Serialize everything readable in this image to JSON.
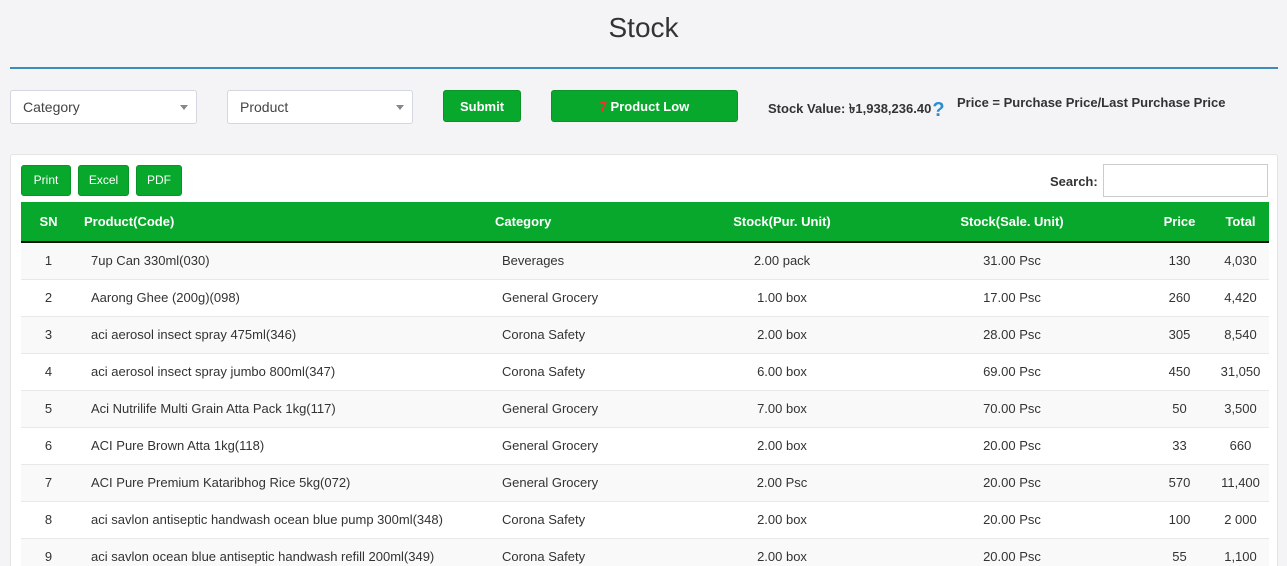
{
  "page": {
    "title": "Stock"
  },
  "filters": {
    "category_placeholder": "Category",
    "product_placeholder": "Product",
    "submit_label": "Submit",
    "low_count": "7",
    "low_label": " Product Low",
    "stock_value_label": "Stock Value: ",
    "stock_value_amount": "৳1,938,236.40",
    "help_icon": "?",
    "price_note": "Price = Purchase Price/Last Purchase Price"
  },
  "toolbar": {
    "print_label": "Print",
    "excel_label": "Excel",
    "pdf_label": "PDF",
    "search_label": "Search:",
    "search_value": ""
  },
  "table": {
    "headers": [
      "SN",
      "Product(Code)",
      "Category",
      "Stock(Pur. Unit)",
      "Stock(Sale. Unit)",
      "Price",
      "Total"
    ],
    "rows": [
      [
        "1",
        "7up Can 330ml(030)",
        "Beverages",
        "2.00 pack",
        "31.00 Psc",
        "130",
        "4,030"
      ],
      [
        "2",
        "Aarong Ghee (200g)(098)",
        "General Grocery",
        "1.00 box",
        "17.00 Psc",
        "260",
        "4,420"
      ],
      [
        "3",
        "aci aerosol insect spray 475ml(346)",
        "Corona Safety",
        "2.00 box",
        "28.00 Psc",
        "305",
        "8,540"
      ],
      [
        "4",
        "aci aerosol insect spray jumbo 800ml(347)",
        "Corona Safety",
        "6.00 box",
        "69.00 Psc",
        "450",
        "31,050"
      ],
      [
        "5",
        "Aci Nutrilife Multi Grain Atta Pack 1kg(117)",
        "General Grocery",
        "7.00 box",
        "70.00 Psc",
        "50",
        "3,500"
      ],
      [
        "6",
        "ACI Pure Brown Atta 1kg(118)",
        "General Grocery",
        "2.00 box",
        "20.00 Psc",
        "33",
        "660"
      ],
      [
        "7",
        "ACI Pure Premium Kataribhog Rice 5kg(072)",
        "General Grocery",
        "2.00 Psc",
        "20.00 Psc",
        "570",
        "11,400"
      ],
      [
        "8",
        "aci savlon antiseptic handwash ocean blue pump 300ml(348)",
        "Corona Safety",
        "2.00 box",
        "20.00 Psc",
        "100",
        "2 000"
      ],
      [
        "9",
        "aci savlon ocean blue antiseptic handwash refill 200ml(349)",
        "Corona Safety",
        "2.00 box",
        "20.00 Psc",
        "55",
        "1,100"
      ]
    ]
  },
  "colors": {
    "accent_green": "#08a82c",
    "title_rule": "#3c8dbc",
    "low_count": "#ff2a2a",
    "help_icon": "#2a8ed0"
  }
}
